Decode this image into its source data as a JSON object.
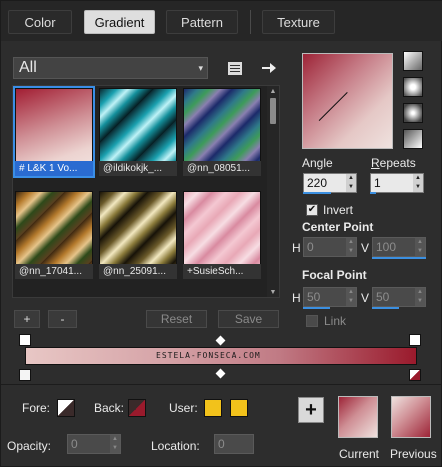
{
  "tabs": [
    {
      "label": "Color",
      "active": false
    },
    {
      "label": "Gradient",
      "active": true
    },
    {
      "label": "Pattern",
      "active": false
    },
    {
      "label": "Texture",
      "active": false
    }
  ],
  "library": {
    "category_selected": "All",
    "items": [
      {
        "label": "# L&K 1 Vo...",
        "selected": true
      },
      {
        "label": "@ildikokjk_...",
        "selected": false
      },
      {
        "label": "@nn_08051...",
        "selected": false
      },
      {
        "label": "@nn_17041...",
        "selected": false
      },
      {
        "label": "@nn_25091...",
        "selected": false
      },
      {
        "label": "+SusieSch...",
        "selected": false
      }
    ],
    "add_label": "+",
    "remove_label": "-",
    "reset_label": "Reset",
    "save_label": "Save"
  },
  "gradient_bar": {
    "watermark": "ESTELA-FONSECA.COM"
  },
  "settings": {
    "angle_label": "Angle",
    "angle_value": "220",
    "repeats_label": "Repeats",
    "repeats_value": "1",
    "invert_label": "Invert",
    "invert_checked": true,
    "center_point_label": "Center Point",
    "center_h_label": "H",
    "center_h_value": "0",
    "center_v_label": "V",
    "center_v_value": "100",
    "focal_point_label": "Focal Point",
    "focal_h_label": "H",
    "focal_h_value": "50",
    "focal_v_label": "V",
    "focal_v_value": "50",
    "link_label": "Link",
    "link_checked": false
  },
  "bottom": {
    "fore_label": "Fore:",
    "back_label": "Back:",
    "user_label": "User:",
    "opacity_label": "Opacity:",
    "opacity_value": "0",
    "location_label": "Location:",
    "location_value": "0",
    "current_label": "Current",
    "previous_label": "Previous"
  },
  "colors": {
    "accent": "#3a8ee6",
    "user_swatch": "#f2c21b",
    "gradient_dark": "#9a1a2c",
    "gradient_light": "#e8c7c5"
  },
  "icons": {
    "library_menu": "list-icon",
    "library_action": "arrow-right-icon",
    "style_linear": "linear-style-icon",
    "style_radial": "radial-style-icon",
    "style_rectangular": "rectangular-style-icon",
    "style_corner": "corner-style-icon",
    "add_gradient": "plus-icon"
  }
}
